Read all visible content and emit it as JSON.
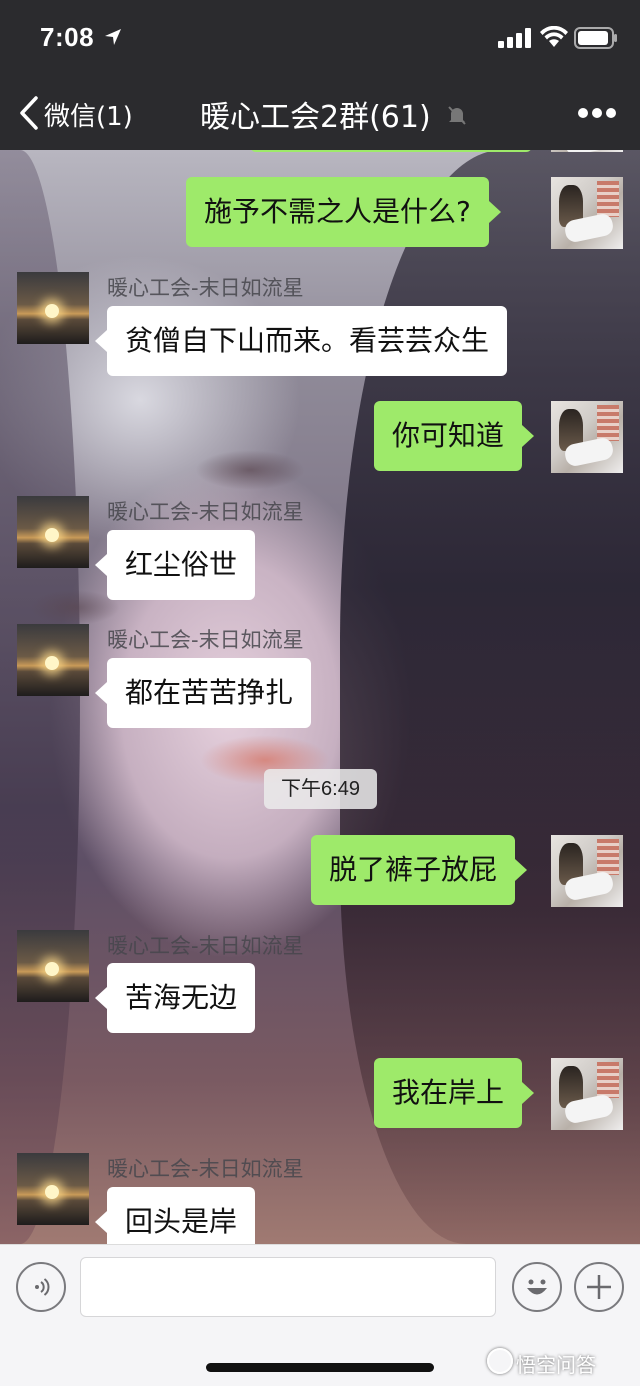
{
  "status_bar": {
    "time": "7:08"
  },
  "nav": {
    "back_label": "微信(1)",
    "title": "暖心工会2群(61)"
  },
  "messages": [
    {
      "side": "out",
      "text": "施予不需之人是什么?"
    },
    {
      "side": "in",
      "sender": "暖心工会-末日如流星",
      "text": "贫僧自下山而来。看芸芸众生"
    },
    {
      "side": "out",
      "text": "你可知道"
    },
    {
      "side": "in",
      "sender": "暖心工会-末日如流星",
      "text": "红尘俗世"
    },
    {
      "side": "in",
      "sender": "暖心工会-末日如流星",
      "text": "都在苦苦挣扎"
    },
    {
      "timestamp": "下午6:49"
    },
    {
      "side": "out",
      "text": "脱了裤子放屁"
    },
    {
      "side": "in",
      "sender": "暖心工会-末日如流星",
      "text": "苦海无边"
    },
    {
      "side": "out",
      "text": "我在岸上"
    },
    {
      "side": "in",
      "sender": "暖心工会-末日如流星",
      "text": "回头是岸"
    }
  ],
  "input": {
    "placeholder": ""
  },
  "watermark": "悟空问答",
  "colors": {
    "outgoing_bubble": "#9eea6a",
    "incoming_bubble": "#ffffff",
    "nav_bg": "#2b2b2e"
  },
  "icons": [
    "location-arrow-icon",
    "signal-icon",
    "wifi-icon",
    "battery-icon",
    "back-chevron-icon",
    "mute-bell-icon",
    "more-dots-icon",
    "voice-icon",
    "emoji-icon",
    "plus-icon"
  ]
}
